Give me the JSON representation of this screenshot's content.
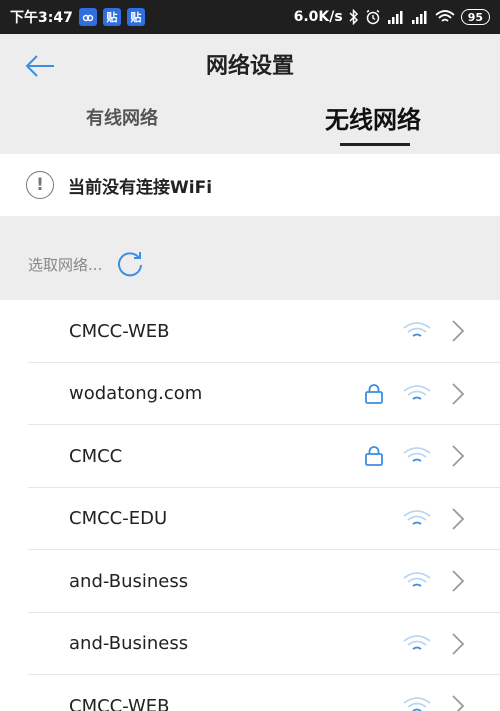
{
  "status_bar": {
    "time": "下午3:47",
    "badges": [
      "贴",
      "贴"
    ],
    "speed": "6.0K/s",
    "battery": "95"
  },
  "header": {
    "title": "网络设置",
    "tabs": [
      {
        "label": "有线网络",
        "selected": false
      },
      {
        "label": "无线网络",
        "selected": true
      }
    ]
  },
  "notice": {
    "text": "当前没有连接WiFi",
    "icon": "!"
  },
  "select": {
    "label": "选取网络..."
  },
  "networks": [
    {
      "ssid": "CMCC-WEB",
      "locked": false
    },
    {
      "ssid": "wodatong.com",
      "locked": true
    },
    {
      "ssid": "CMCC",
      "locked": true
    },
    {
      "ssid": "CMCC-EDU",
      "locked": false
    },
    {
      "ssid": "and-Business",
      "locked": false
    },
    {
      "ssid": "and-Business",
      "locked": false
    },
    {
      "ssid": "CMCC-WEB",
      "locked": false
    }
  ],
  "colors": {
    "accent": "#3b8fe0",
    "wifi_weak": "#bcd7ef",
    "chevron": "#9a9a9a"
  }
}
